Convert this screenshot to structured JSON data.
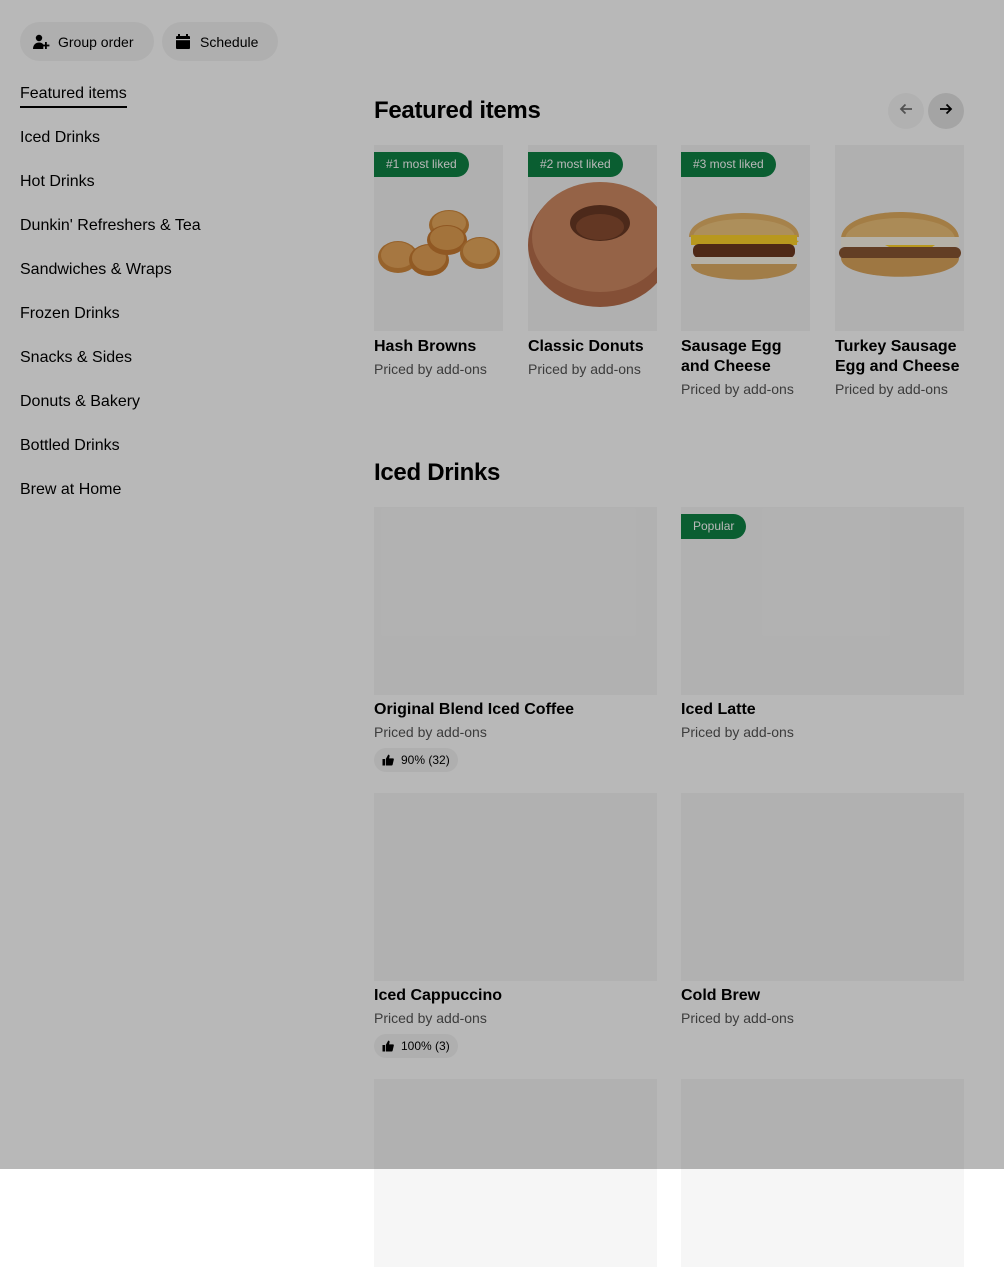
{
  "header": {
    "group_order_label": "Group order",
    "schedule_label": "Schedule"
  },
  "sidebar": {
    "items": [
      {
        "label": "Featured items",
        "active": true
      },
      {
        "label": "Iced Drinks"
      },
      {
        "label": "Hot Drinks"
      },
      {
        "label": "Dunkin' Refreshers & Tea"
      },
      {
        "label": "Sandwiches & Wraps"
      },
      {
        "label": "Frozen Drinks"
      },
      {
        "label": "Snacks & Sides"
      },
      {
        "label": "Donuts & Bakery"
      },
      {
        "label": "Bottled Drinks"
      },
      {
        "label": "Brew at Home"
      }
    ]
  },
  "featured": {
    "title": "Featured items",
    "items": [
      {
        "badge": "#1 most liked",
        "name": "Hash Browns",
        "price": "Priced by add-ons",
        "icon": "hash-browns-image"
      },
      {
        "badge": "#2 most liked",
        "name": "Classic Donuts",
        "price": "Priced by add-ons",
        "icon": "donut-image"
      },
      {
        "badge": "#3 most liked",
        "name": "Sausage Egg and Cheese",
        "price": "Priced by add-ons",
        "icon": "sandwich-image"
      },
      {
        "badge": "",
        "name": "Turkey Sausage Egg and Cheese",
        "price": "Priced by add-ons",
        "icon": "sandwich-image"
      }
    ]
  },
  "iced": {
    "title": "Iced Drinks",
    "items": [
      {
        "badge": "",
        "name": "Original Blend Iced Coffee",
        "price": "Priced by add-ons",
        "rating": "90% (32)"
      },
      {
        "badge": "Popular",
        "name": "Iced Latte",
        "price": "Priced by add-ons",
        "rating": ""
      },
      {
        "badge": "",
        "name": "Iced Cappuccino",
        "price": "Priced by add-ons",
        "rating": "100% (3)"
      },
      {
        "badge": "",
        "name": "Cold Brew",
        "price": "Priced by add-ons",
        "rating": ""
      }
    ]
  },
  "colors": {
    "badge_green": "#0e8345",
    "overlay": "rgba(0,0,0,0.28)"
  }
}
